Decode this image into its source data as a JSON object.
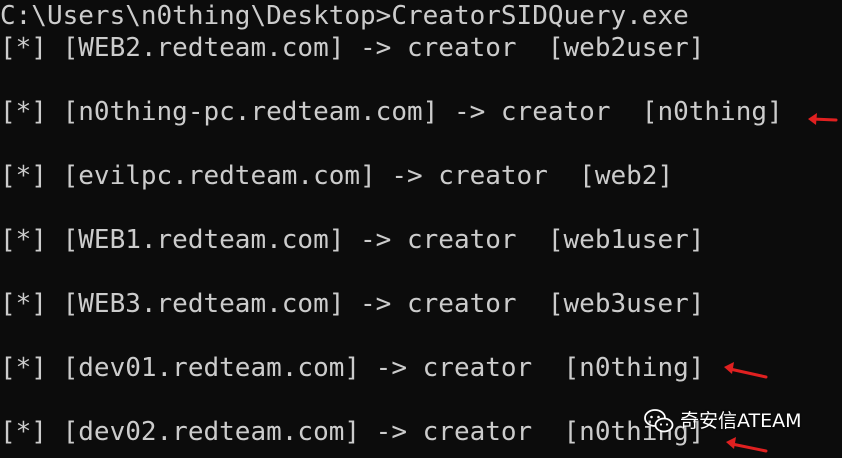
{
  "terminal": {
    "command_line": "C:\\Users\\n0thing\\Desktop>CreatorSIDQuery.exe",
    "output_lines": [
      "[*] [WEB2.redteam.com] -> creator  [web2user]",
      "[*] [n0thing-pc.redteam.com] -> creator  [n0thing]",
      "[*] [evilpc.redteam.com] -> creator  [web2]",
      "[*] [WEB1.redteam.com] -> creator  [web1user]",
      "[*] [WEB3.redteam.com] -> creator  [web3user]",
      "[*] [dev01.redteam.com] -> creator  [n0thing]",
      "[*] [dev02.redteam.com] -> creator  [n0thing]"
    ]
  },
  "annotations": {
    "arrow_color": "#e02020"
  },
  "watermark": {
    "icon": "wechat-icon",
    "text": "奇安信ATEAM"
  },
  "colors": {
    "background": "#0c0c0c",
    "text": "#cccccc"
  }
}
